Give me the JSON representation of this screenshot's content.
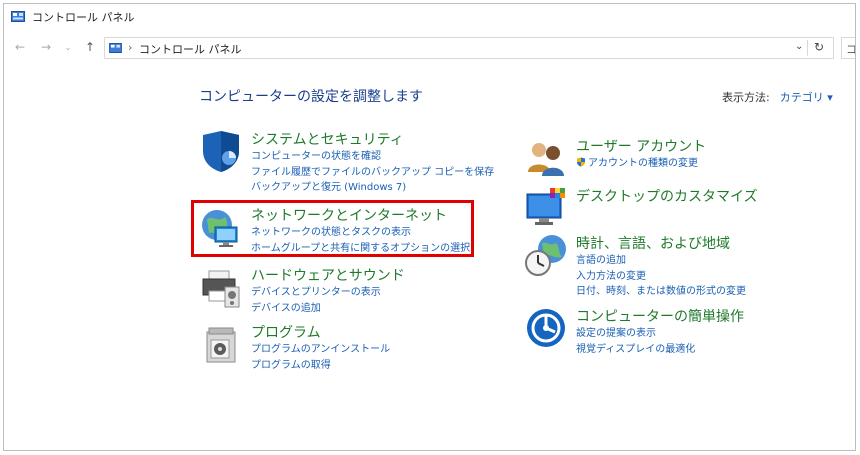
{
  "window": {
    "title": "コントロール パネル"
  },
  "address": {
    "path": "コントロール パネル",
    "search_text": "コン"
  },
  "main": {
    "heading": "コンピューターの設定を調整します",
    "view_by_label": "表示方法:",
    "view_by_value": "カテゴリ ▾"
  },
  "categories_left": [
    {
      "title": "システムとセキュリティ",
      "links": [
        "コンピューターの状態を確認",
        "ファイル履歴でファイルのバックアップ コピーを保存",
        "バックアップと復元 (Windows 7)"
      ]
    },
    {
      "title": "ネットワークとインターネット",
      "links": [
        "ネットワークの状態とタスクの表示",
        "ホームグループと共有に関するオプションの選択"
      ]
    },
    {
      "title": "ハードウェアとサウンド",
      "links": [
        "デバイスとプリンターの表示",
        "デバイスの追加"
      ]
    },
    {
      "title": "プログラム",
      "links": [
        "プログラムのアンインストール",
        "プログラムの取得"
      ]
    }
  ],
  "categories_right": [
    {
      "title": "ユーザー アカウント",
      "links": [
        "アカウントの種類の変更"
      ]
    },
    {
      "title": "デスクトップのカスタマイズ",
      "links": []
    },
    {
      "title": "時計、言語、および地域",
      "links": [
        "言語の追加",
        "入力方法の変更",
        "日付、時刻、または数値の形式の変更"
      ]
    },
    {
      "title": "コンピューターの簡単操作",
      "links": [
        "設定の提案の表示",
        "視覚ディスプレイの最適化"
      ]
    }
  ],
  "colors": {
    "category_title": "#1e7a2a",
    "link": "#1a5fb4",
    "heading": "#1a3e8c",
    "highlight_border": "#e00000"
  },
  "icons": {
    "window": "control-panel-icon",
    "back": "arrow-left-icon",
    "forward": "arrow-right-icon",
    "recent": "chevron-down-icon",
    "up": "arrow-up-icon",
    "refresh": "refresh-icon"
  }
}
